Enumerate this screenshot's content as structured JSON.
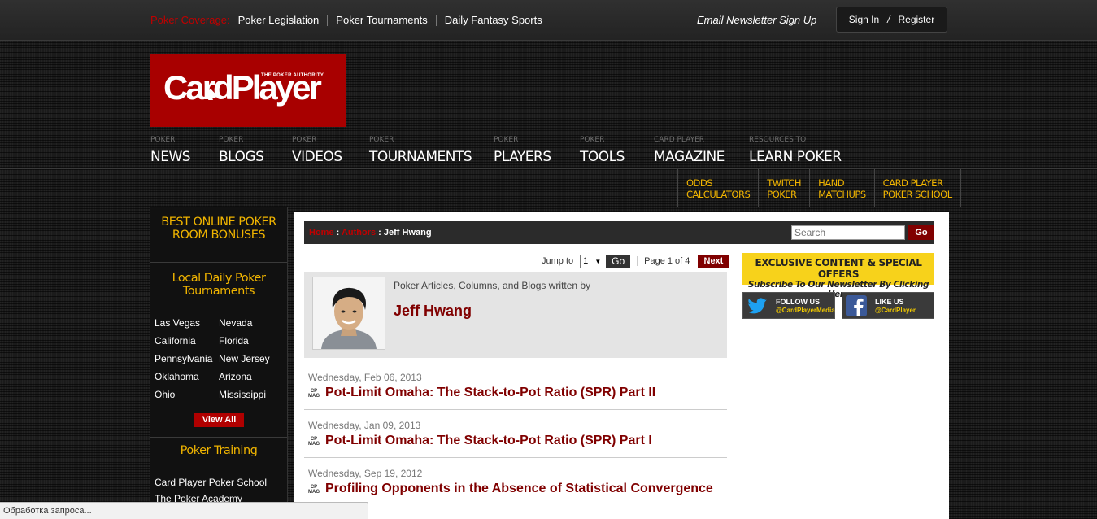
{
  "topbar": {
    "coverage_label": "Poker Coverage:",
    "links": [
      "Poker Legislation",
      "Poker Tournaments",
      "Daily Fantasy Sports"
    ],
    "newsletter": "Email Newsletter Sign Up",
    "sign_in": "Sign In",
    "auth_separator": "/",
    "register": "Register"
  },
  "logo": {
    "wordmark": "CardPlayer",
    "tagline": "THE POKER AUTHORITY"
  },
  "nav": [
    {
      "small": "Poker",
      "large": "NEWS"
    },
    {
      "small": "Poker",
      "large": "BLOGS"
    },
    {
      "small": "Poker",
      "large": "VIDEOS"
    },
    {
      "small": "Poker",
      "large": "TOURNAMENTS"
    },
    {
      "small": "Poker",
      "large": "PLAYERS"
    },
    {
      "small": "Poker",
      "large": "TOOLS"
    },
    {
      "small": "Card Player",
      "large": "MAGAZINE"
    },
    {
      "small": "Resources to",
      "large": "LEARN POKER"
    }
  ],
  "subnav": [
    {
      "l1": "ODDS",
      "l2": "CALCULATORS"
    },
    {
      "l1": "TWITCH",
      "l2": "POKER"
    },
    {
      "l1": "HAND",
      "l2": "MATCHUPS"
    },
    {
      "l1": "CARD PLAYER",
      "l2": "POKER SCHOOL"
    }
  ],
  "sidebar": {
    "bonuses_l1": "BEST ONLINE POKER",
    "bonuses_l2": "ROOM BONUSES",
    "local_l1": "Local Daily Poker",
    "local_l2": "Tournaments",
    "locations": [
      [
        "Las Vegas",
        "Nevada"
      ],
      [
        "California",
        "Florida"
      ],
      [
        "Pennsylvania",
        "New Jersey"
      ],
      [
        "Oklahoma",
        "Arizona"
      ],
      [
        "Ohio",
        "Mississippi"
      ]
    ],
    "view_all": "View All",
    "training_title": "Poker Training",
    "training_items": [
      "Card Player Poker School",
      "The Poker Academy"
    ]
  },
  "breadcrumb": {
    "home": "Home",
    "sep": " : ",
    "authors": "Authors",
    "current": "Jeff Hwang"
  },
  "search": {
    "placeholder": "Search",
    "button": "Go"
  },
  "pager": {
    "jump_label": "Jump to",
    "selected": "1",
    "go": "Go",
    "page_text": "Page 1 of 4",
    "next": "Next"
  },
  "author": {
    "subtitle": "Poker Articles, Columns, and Blogs written by",
    "name": "Jeff Hwang"
  },
  "articles": [
    {
      "date": "Wednesday, Feb 06, 2013",
      "badge_l1": "CP",
      "badge_l2": "MAG",
      "title": "Pot-Limit Omaha: The Stack-to-Pot Ratio (SPR) Part II"
    },
    {
      "date": "Wednesday, Jan 09, 2013",
      "badge_l1": "CP",
      "badge_l2": "MAG",
      "title": "Pot-Limit Omaha: The Stack-to-Pot Ratio (SPR) Part I"
    },
    {
      "date": "Wednesday, Sep 19, 2012",
      "badge_l1": "CP",
      "badge_l2": "MAG",
      "title": "Profiling Opponents in the Absence of Statistical Convergence"
    }
  ],
  "promo": {
    "l1": "EXCLUSIVE CONTENT & SPECIAL OFFERS",
    "l2": "Subscribe To Our Newsletter By Clicking Here"
  },
  "social": {
    "twitter": {
      "l1": "FOLLOW US",
      "l2": "@CardPlayerMedia"
    },
    "facebook": {
      "l1": "LIKE US",
      "l2": "@CardPlayer"
    }
  },
  "status_text": "Обработка запроса...",
  "colors": {
    "brand_red": "#a80000",
    "dark_red": "#800000",
    "gold": "#f0b400",
    "promo_yellow": "#f7d21b"
  }
}
